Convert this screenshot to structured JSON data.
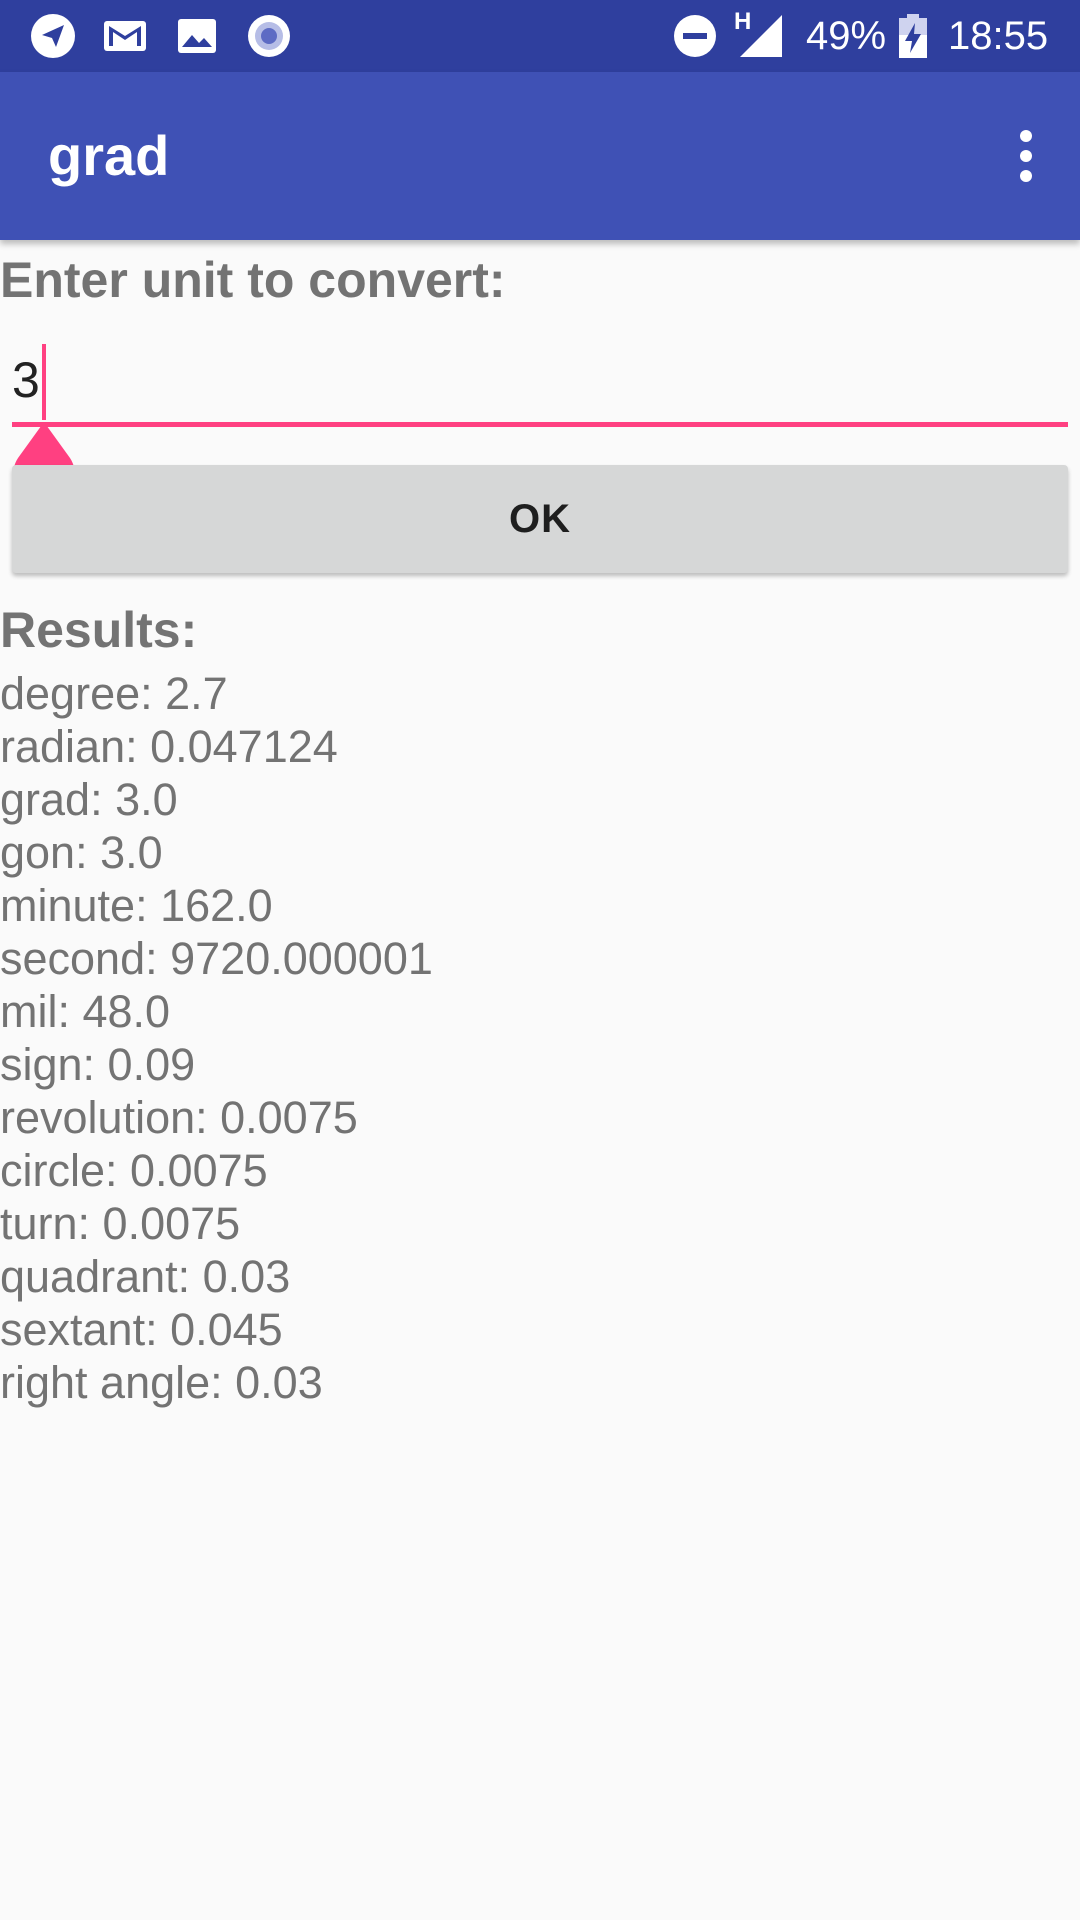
{
  "status_bar": {
    "battery": "49%",
    "time": "18:55",
    "network_type": "H",
    "icons": [
      "telegram-icon",
      "gmail-icon",
      "gallery-icon",
      "record-icon",
      "do-not-disturb-icon",
      "signal-icon",
      "battery-charging-icon"
    ]
  },
  "app_bar": {
    "title": "grad",
    "menu_icon": "more-vert-icon"
  },
  "form": {
    "prompt": "Enter unit to convert:",
    "input_value": "3",
    "ok_label": "OK"
  },
  "results": {
    "title": "Results:",
    "items": [
      "degree: 2.7",
      "radian: 0.047124",
      "grad: 3.0",
      "gon: 3.0",
      "minute: 162.0",
      "second: 9720.000001",
      "mil: 48.0",
      "sign: 0.09",
      "revolution: 0.0075",
      "circle: 0.0075",
      "turn: 0.0075",
      "quadrant: 0.03",
      "sextant: 0.045",
      "right angle: 0.03"
    ]
  },
  "colors": {
    "status_bar": "#2f3f9e",
    "app_bar": "#3f51b5",
    "accent": "#ff4081",
    "button": "#d6d7d7",
    "text_secondary": "#737373"
  }
}
